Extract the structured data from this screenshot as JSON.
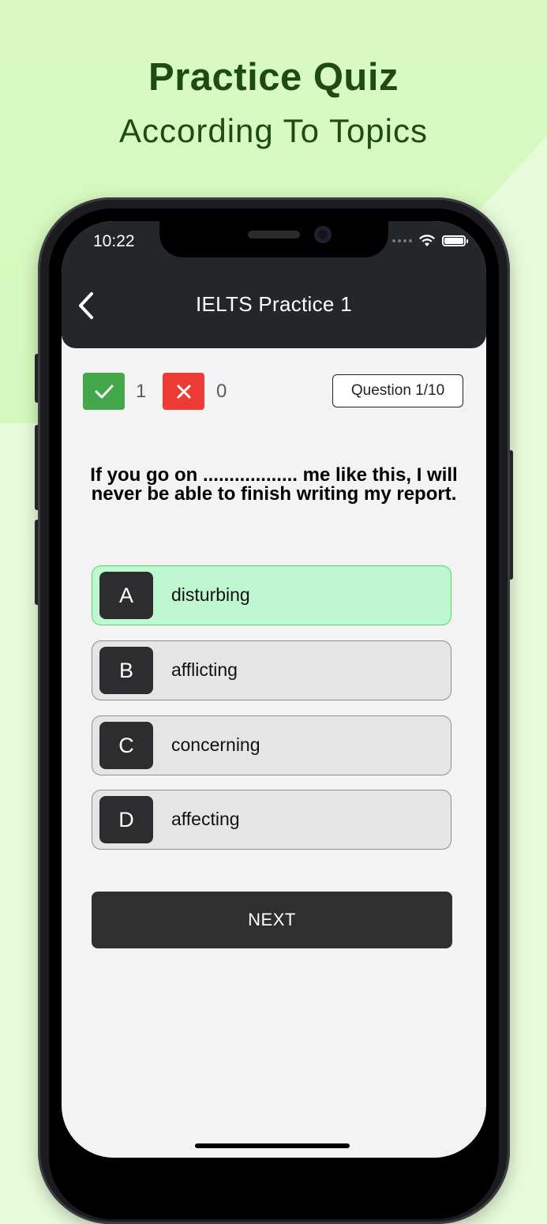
{
  "promo": {
    "title": "Practice Quiz",
    "subtitle": "According To Topics"
  },
  "status_bar": {
    "time": "10:22"
  },
  "header": {
    "title": "IELTS Practice 1"
  },
  "score": {
    "correct": "1",
    "wrong": "0",
    "question_counter": "Question 1/10"
  },
  "question": {
    "text": "If you go on .................. me like this, I will never be able to finish writing my report."
  },
  "options": [
    {
      "letter": "A",
      "text": "disturbing",
      "selected": true
    },
    {
      "letter": "B",
      "text": "afflicting",
      "selected": false
    },
    {
      "letter": "C",
      "text": "concerning",
      "selected": false
    },
    {
      "letter": "D",
      "text": "affecting",
      "selected": false
    }
  ],
  "next_button": {
    "label": "NEXT"
  },
  "colors": {
    "correct": "#43a84b",
    "wrong": "#ef3b35",
    "selected_option": "#bff8d0",
    "header_bg": "#23272a"
  }
}
